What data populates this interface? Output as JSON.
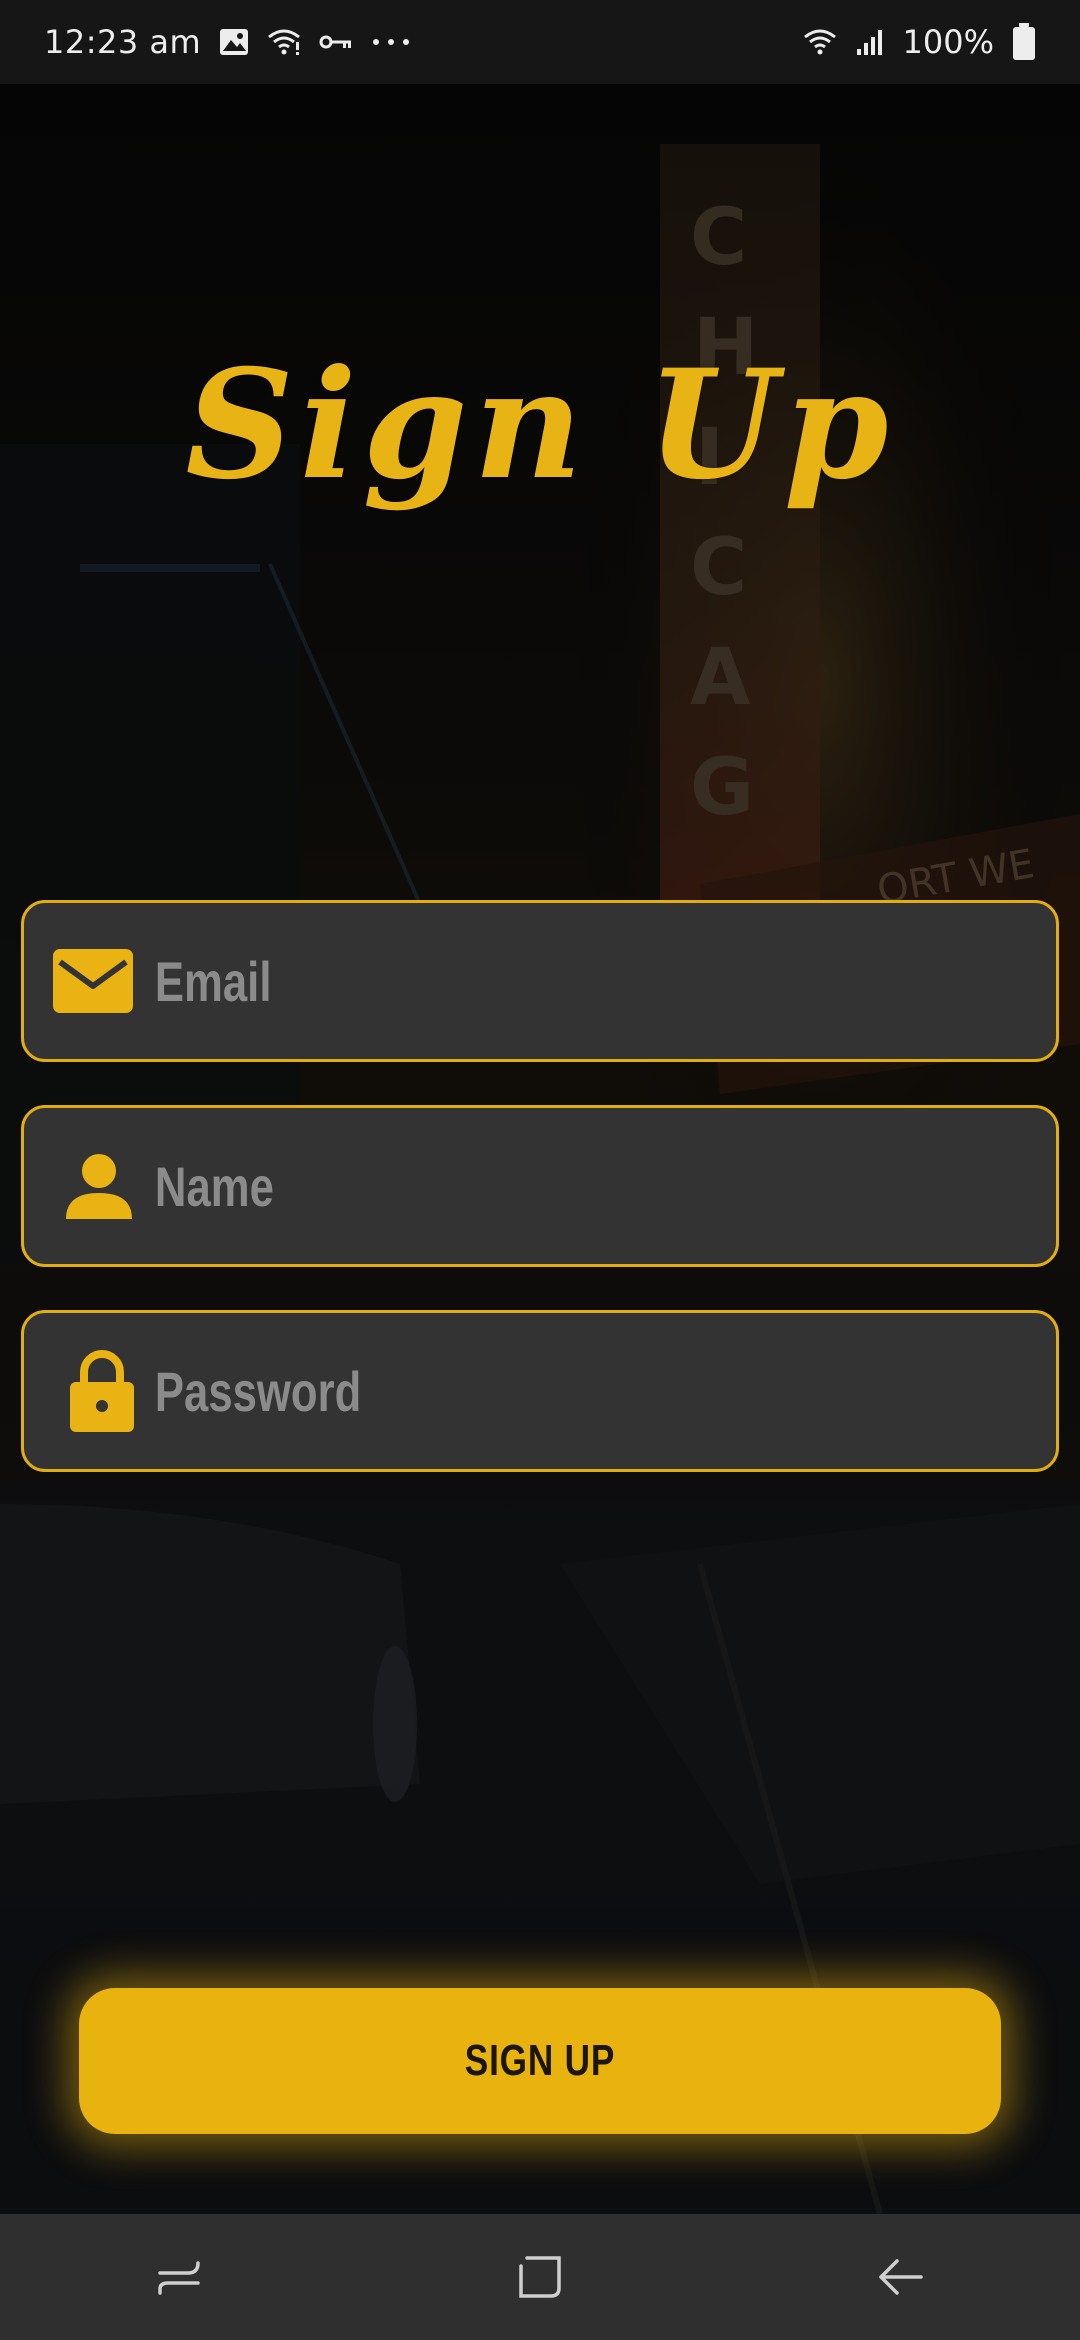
{
  "status_bar": {
    "time": "12:23 am",
    "battery": "100%",
    "icons_left": [
      "image-icon",
      "wifi-icon",
      "key-icon",
      "more-dots-icon"
    ],
    "icons_right": [
      "wifi-icon",
      "signal-icon",
      "battery-icon"
    ]
  },
  "title": "Sign Up",
  "form": {
    "email": {
      "placeholder": "Email",
      "value": "",
      "icon": "envelope-icon"
    },
    "name": {
      "placeholder": "Name",
      "value": "",
      "icon": "person-icon"
    },
    "password": {
      "placeholder": "Password",
      "value": "",
      "icon": "lock-icon"
    }
  },
  "button": {
    "label": "SIGN UP"
  },
  "nav": {
    "items": [
      "recent-apps-icon",
      "home-icon",
      "back-icon"
    ]
  },
  "colors": {
    "accent": "#e9b30f",
    "field_bg": "#333333",
    "placeholder": "#8b8b8b",
    "status_bar_bg": "#161616",
    "nav_bg": "#2f2f2f"
  }
}
